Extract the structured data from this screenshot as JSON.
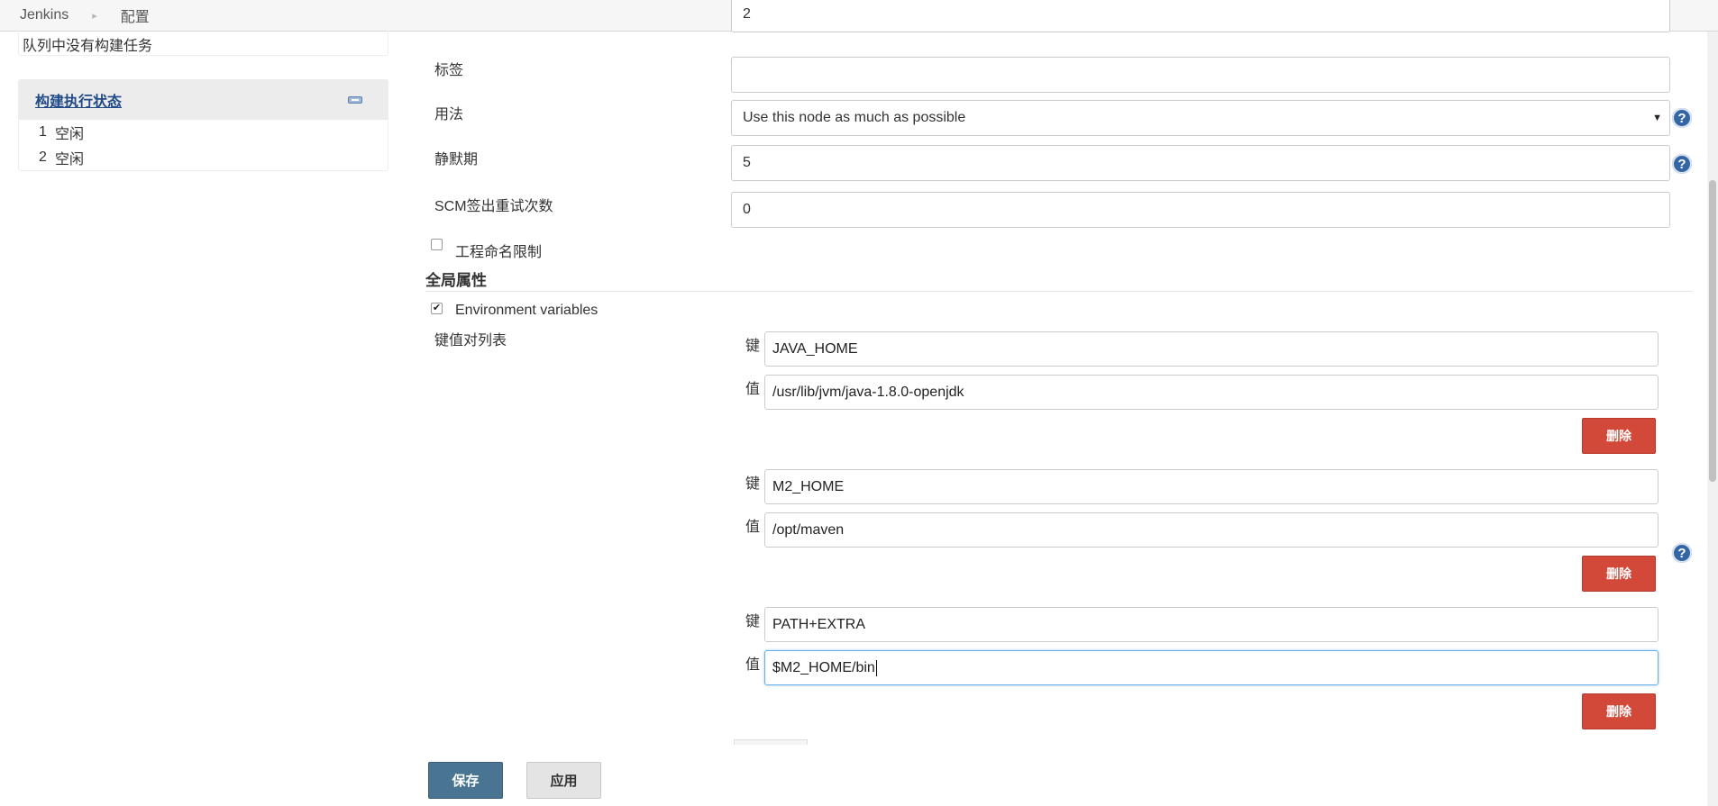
{
  "breadcrumb": {
    "home": "Jenkins",
    "separator": "▸",
    "current": "配置"
  },
  "sidebar": {
    "queue_text": "队列中没有构建任务",
    "executors": {
      "title": "构建执行状态",
      "items": [
        {
          "num": "1",
          "status": "空闲"
        },
        {
          "num": "2",
          "status": "空闲"
        }
      ]
    }
  },
  "form": {
    "executors_value": "2",
    "labels_label": "标签",
    "labels_value": "",
    "usage_label": "用法",
    "usage_value": "Use this node as much as possible",
    "quiet_period_label": "静默期",
    "quiet_period_value": "5",
    "scm_retry_label": "SCM签出重试次数",
    "scm_retry_value": "0",
    "restrict_naming_label": "工程命名限制",
    "restrict_naming_checked": false,
    "global_props_title": "全局属性",
    "env_vars_label": "Environment variables",
    "env_vars_checked": true,
    "kv_list_label": "键值对列表",
    "key_label": "键",
    "value_label": "值",
    "delete_label": "删除",
    "env_vars": [
      {
        "key": "JAVA_HOME",
        "value": "/usr/lib/jvm/java-1.8.0-openjdk"
      },
      {
        "key": "M2_HOME",
        "value": "/opt/maven"
      },
      {
        "key": "PATH+EXTRA",
        "value": "$M2_HOME/bin"
      }
    ]
  },
  "buttons": {
    "save": "保存",
    "apply": "应用"
  },
  "help_glyph": "?",
  "colors": {
    "delete": "#d24939",
    "save": "#4a7592",
    "help": "#3465a4",
    "link": "#204a87"
  }
}
